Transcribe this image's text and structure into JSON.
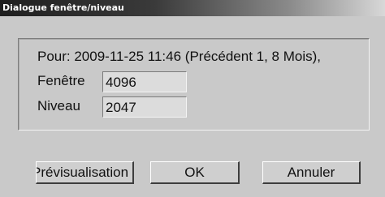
{
  "window": {
    "title": "Dialogue fenêtre/niveau"
  },
  "info": {
    "text": "Pour: 2009-11-25 11:46 (Précédent 1, 8 Mois),"
  },
  "fields": {
    "window_label": "Fenêtre",
    "window_value": "4096",
    "level_label": "Niveau",
    "level_value": "2047"
  },
  "buttons": {
    "preview": "Prévisualisation",
    "ok": "OK",
    "cancel": "Annuler"
  }
}
